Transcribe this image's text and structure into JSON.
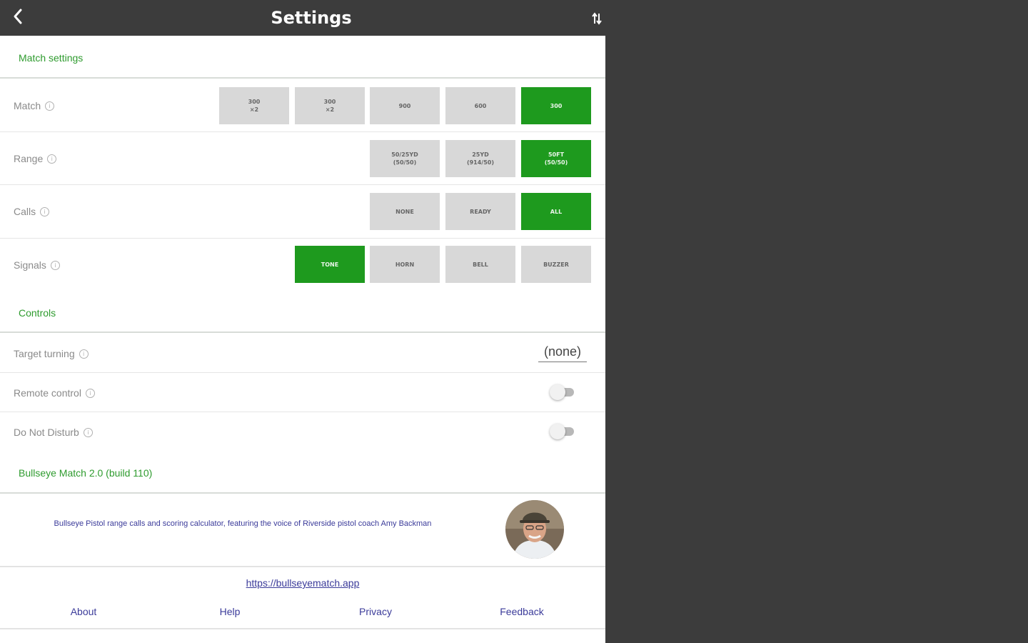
{
  "header": {
    "title": "Settings"
  },
  "sections": {
    "match_settings": "Match settings",
    "controls": "Controls",
    "version": "Bullseye Match 2.0 (build 110)"
  },
  "rows": {
    "match": {
      "label": "Match",
      "options": [
        "300\n×2",
        "300\n×2",
        "900",
        "600",
        "300"
      ],
      "selected_index": 4
    },
    "range": {
      "label": "Range",
      "options": [
        "50/25YD\n(50/50)",
        "25YD\n(914/50)",
        "50FT\n(50/50)"
      ],
      "selected_index": 2
    },
    "calls": {
      "label": "Calls",
      "options": [
        "NONE",
        "READY",
        "ALL"
      ],
      "selected_index": 2
    },
    "signals": {
      "label": "Signals",
      "options": [
        "TONE",
        "HORN",
        "BELL",
        "BUZZER"
      ],
      "selected_index": 0
    },
    "target_turning": {
      "label": "Target turning",
      "value": "(none)"
    },
    "remote_control": {
      "label": "Remote control",
      "enabled": false
    },
    "do_not_disturb": {
      "label": "Do Not Disturb",
      "enabled": false
    }
  },
  "about": {
    "description": "Bullseye Pistol range calls and scoring calculator, featuring the voice of Riverside pistol coach Amy Backman",
    "link": "https://bullseyematch.app",
    "footer": [
      "About",
      "Help",
      "Privacy",
      "Feedback"
    ]
  },
  "colors": {
    "accent_green": "#1e9a1e",
    "header_bg": "#3c3c3c",
    "link_blue": "#3b3b9a"
  }
}
